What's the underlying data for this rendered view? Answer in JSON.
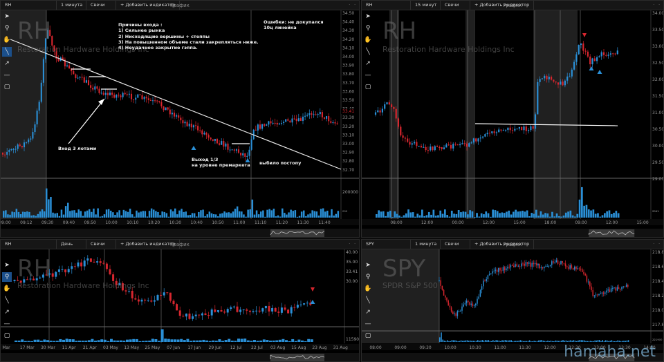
{
  "panels": {
    "tl": {
      "symbol": "RH",
      "interval": "1 минута",
      "chart_type": "Свечи",
      "add_indicator": "+ Добавить индикатор",
      "center_title": "График",
      "watermark_symbol": "RH",
      "watermark_name": "Restoration Hardware Holdings Inc",
      "price_labels": [
        "34.50",
        "34.40",
        "34.30",
        "34.20",
        "34.10",
        "34.00",
        "33.90",
        "33.80",
        "33.70",
        "33.60",
        "33.50",
        "33.40",
        "33.30",
        "33.20",
        "33.10",
        "33.00",
        "32.90",
        "32.80",
        "32.70"
      ],
      "time_labels": [
        "09:00",
        "09:12",
        "09:30",
        "09:40",
        "09:50",
        "10:00",
        "10:10",
        "10:20",
        "10:30",
        "10:40",
        "10:50",
        "11:00",
        "11:10",
        "11:20",
        "11:30",
        "11:40"
      ],
      "volume_label": "200000",
      "volume_small": "₀₀₀",
      "last_price": "33.41",
      "annotations": {
        "reasons": "Причины входа :\n1) Сильнее рынка\n2) Нисходящие вершины + степпы\n3) На повышенном объеме стали закрепляться ниже.\n4) Неудачное закрытие гэппа.",
        "errors": "Ошибки: не докупался\n10ц линейка",
        "entry": "Вход 3 лотами",
        "exit": "Выход 1/3\nна уровне премаркета",
        "stopped": "выбило постопу"
      }
    },
    "tr": {
      "symbol": "RH",
      "interval": "15 минут",
      "chart_type": "Свечи",
      "add_indicator": "+ Добавить индикатор",
      "center_title": "График",
      "watermark_symbol": "RH",
      "watermark_name": "Restoration Hardware Holdings Inc",
      "price_labels": [
        "34.00",
        "33.50",
        "33.00",
        "32.50",
        "32.00",
        "31.50",
        "31.00",
        "30.50",
        "30.00",
        "29.50",
        "29.00"
      ],
      "time_labels": [
        "08:00",
        "12:00",
        "00:00",
        "12:00",
        "15:00",
        "18:00",
        "09:00",
        "12:00",
        "15:00"
      ],
      "volume_small": "₂₅₆₁"
    },
    "bl": {
      "symbol": "RH",
      "interval": "День",
      "chart_type": "Свечи",
      "add_indicator": "+ Добавить индикатор",
      "center_title": "График",
      "watermark_symbol": "RH",
      "watermark_name": "Restoration Hardware Holdings Inc",
      "price_labels": [
        "40.00",
        "35.00",
        "33.41",
        "30.00"
      ],
      "time_labels": [
        "Mar",
        "17 Mar",
        "30 Mar",
        "11 Apr",
        "21 Apr",
        "03 May",
        "13 May",
        "25 May",
        "07 Jun",
        "17 Jun",
        "29 Jun",
        "12 Jul",
        "22 Jul",
        "03 Aug",
        "15 Aug",
        "23 Aug",
        "31 Aug"
      ],
      "volume_small": "1159045"
    },
    "br": {
      "symbol": "SPY",
      "interval": "1 минута",
      "chart_type": "Свечи",
      "add_indicator": "+ Добавить индикатор",
      "center_title": "График",
      "watermark_symbol": "SPY",
      "watermark_name": "SPDR S&P 500",
      "price_labels": [
        "218.80",
        "218.60",
        "218.40",
        "218.20",
        "218.00",
        "217.80"
      ],
      "time_labels": [
        "08:00",
        "09:00",
        "09:30",
        "10:00",
        "10:30",
        "11:00",
        "11:30",
        "12:00",
        "12:30",
        "13:00",
        "13:30",
        "14:00"
      ],
      "volume_small": "₂₂₁₉₀₀"
    }
  },
  "colors": {
    "up": "#2a8fd6",
    "down": "#d7262e",
    "premarket_bg": "#3a3a3a",
    "line": "#e8e8e8"
  },
  "site_watermark": "hamaha.net"
}
